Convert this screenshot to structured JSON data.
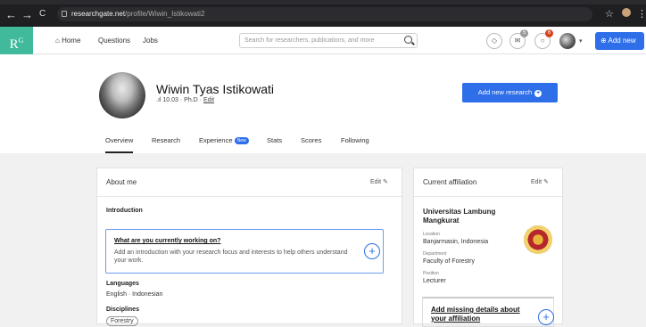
{
  "browser": {
    "url_host": "researchgate.net",
    "url_path": "/profile/Wiwin_Istikowati2",
    "back": "←",
    "forward": "→",
    "reload": "C"
  },
  "topnav": {
    "logo": "R",
    "logo_sup": "G",
    "home": "Home",
    "questions": "Questions",
    "jobs": "Jobs",
    "search_placeholder": "Search for researchers, publications, and more",
    "badge_messages": "5",
    "badge_notifications": "6",
    "add_new": "Add new"
  },
  "profile": {
    "name": "Wiwin Tyas Istikowati",
    "score": "10.03",
    "degree": "Ph.D",
    "edit": "Edit",
    "add_research": "Add new research"
  },
  "tabs": [
    {
      "label": "Overview"
    },
    {
      "label": "Research"
    },
    {
      "label": "Experience"
    },
    {
      "label": "Stats"
    },
    {
      "label": "Scores"
    },
    {
      "label": "Following"
    }
  ],
  "tab_new_badge": "New",
  "about": {
    "title": "About me",
    "edit": "Edit",
    "intro_label": "Introduction",
    "prompt_question": "What are you currently working on?",
    "prompt_desc": "Add an introduction with your research focus and interests to help others understand your work.",
    "languages_label": "Languages",
    "languages": "English · Indonesian",
    "disciplines_label": "Disciplines",
    "discipline": "Forestry"
  },
  "affiliation": {
    "title": "Current affiliation",
    "edit": "Edit",
    "institution": "Universitas Lambung Mangkurat",
    "location_label": "Location",
    "location": "Banjarmasin, Indonesia",
    "department_label": "Department",
    "department": "Faculty of Forestry",
    "position_label": "Position",
    "position": "Lecturer",
    "missing": "Add missing details about your affiliation"
  }
}
